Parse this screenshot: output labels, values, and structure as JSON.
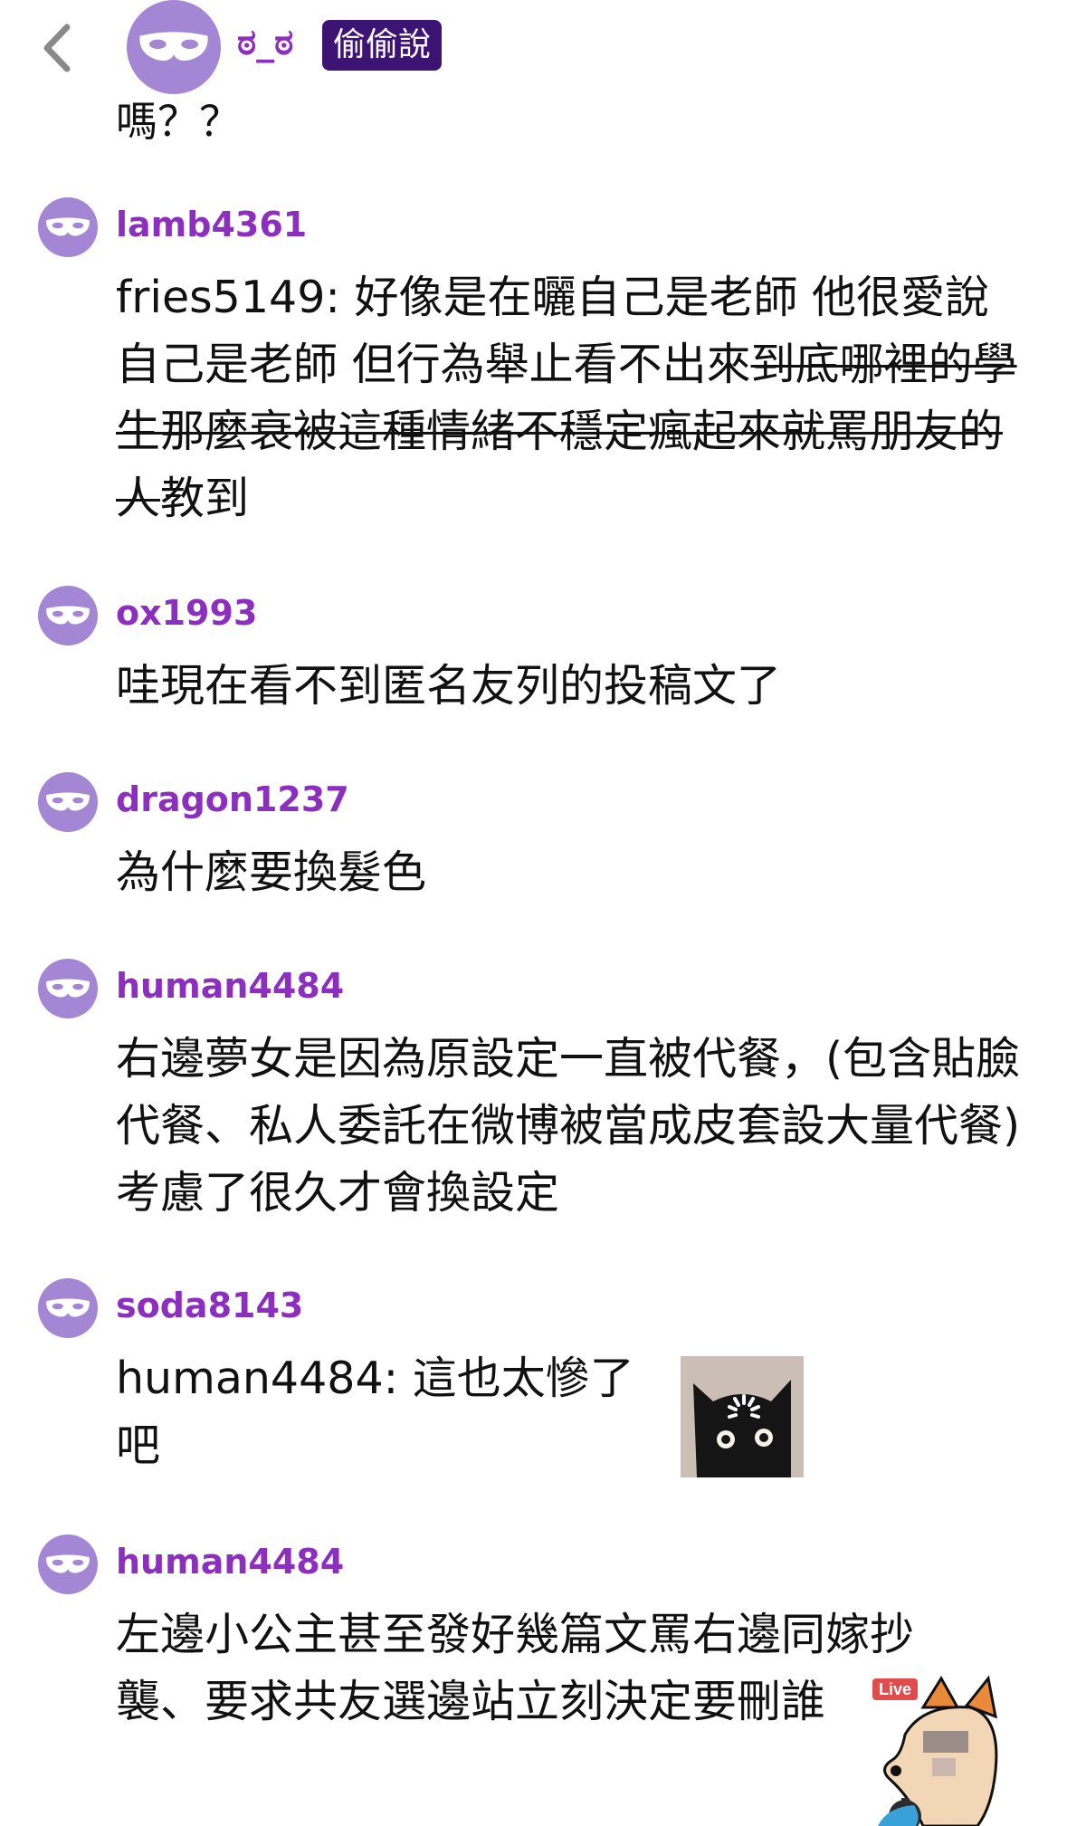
{
  "header": {
    "username": "ಠ_ಠ",
    "badge": "偷偷說",
    "tail_text": "嗎？？"
  },
  "comments": [
    {
      "user": "lamb4361",
      "text_plain": "fries5149: 好像是在曬自己是老師 他很愛說自己是老師 但行為舉止看不出來",
      "text_strike": "到底哪裡的學生那麼衰被這種情緒不穩定瘋起來就罵朋友的人",
      "text_tail": "教到"
    },
    {
      "user": "ox1993",
      "text": "哇現在看不到匿名友列的投稿文了"
    },
    {
      "user": "dragon1237",
      "text": "為什麼要換髮色"
    },
    {
      "user": "human4484",
      "text": "右邊夢女是因為原設定一直被代餐，(包含貼臉代餐、私人委託在微博被當成皮套設大量代餐) 考慮了很久才會換設定"
    },
    {
      "user": "soda8143",
      "text": "human4484: 這也太慘了吧"
    },
    {
      "user": "human4484",
      "text": "左邊小公主甚至發好幾篇文罵右邊同嫁抄襲、要求共友選邊站立刻決定要刪誰"
    }
  ],
  "stickers": {
    "cat_icon": "cat-loading-sticker",
    "fox_icon": "fox-live-sticker",
    "fox_label": "Live"
  },
  "colors": {
    "username": "#8d2fbe",
    "avatar_bg": "#a487d4",
    "badge_bg": "#3d1474"
  }
}
